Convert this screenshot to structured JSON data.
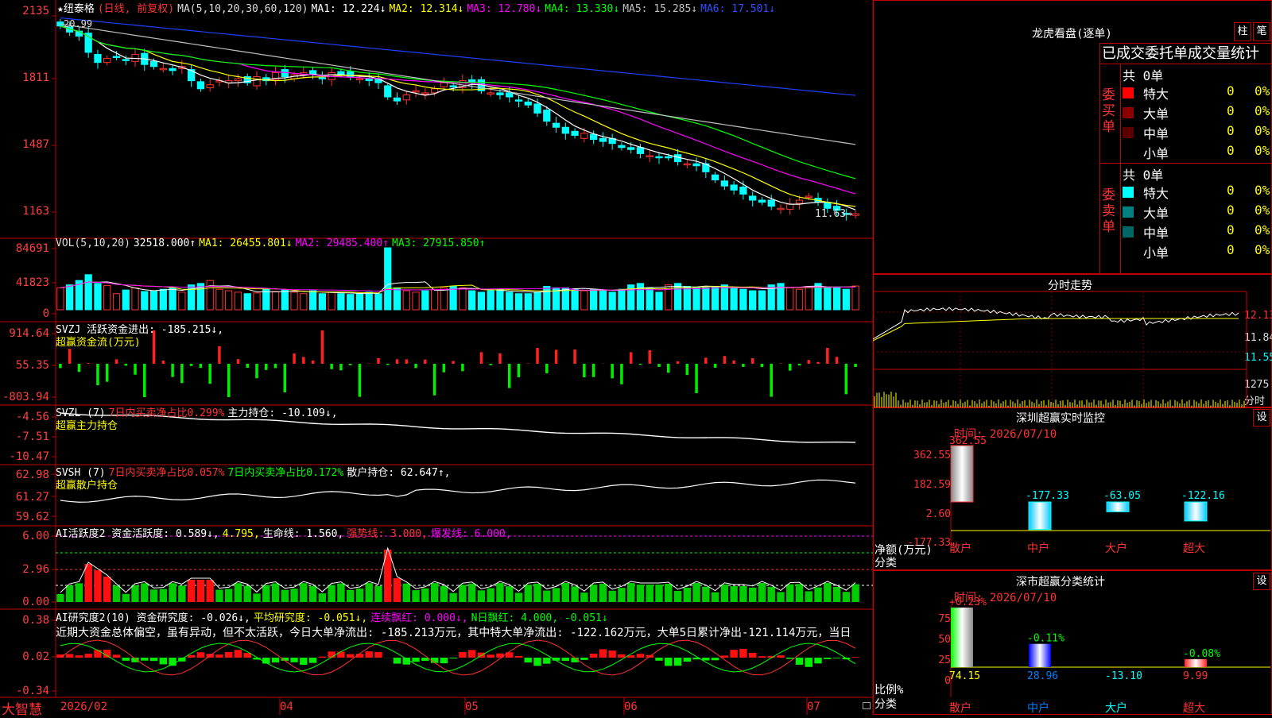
{
  "header": {
    "title": "★纽泰格",
    "period": "(日线, 前复权)",
    "ma_label": "MA(5,10,20,30,60,120)",
    "ma1": "MA1: 12.224↓",
    "ma2": "MA2: 12.314↓",
    "ma3": "MA3: 12.780↓",
    "ma4": "MA4: 13.330↓",
    "ma5": "MA5: 15.285↓",
    "ma6": "MA6: 17.501↓",
    "high_mark": "20.99",
    "low_mark": "11.63→"
  },
  "price_axis": [
    "2135",
    "1811",
    "1487",
    "1163"
  ],
  "vol": {
    "label": "VOL(5,10,20)",
    "value": "32518.000↑",
    "ma1": "MA1: 26455.801↓",
    "ma2": "MA2: 29485.400↑",
    "ma3": "MA3: 27915.850↑",
    "axis": [
      "84691",
      "41823",
      "0"
    ]
  },
  "svzj": {
    "label": "SVZJ  活跃资金进出: -185.215↓,",
    "sub": "超赢资金流(万元)",
    "axis": [
      "914.64",
      "55.35",
      "-803.94"
    ]
  },
  "svzl": {
    "label": "SVZL (7)",
    "pct": "7日内买卖净占比0.299%",
    "hold": "主力持仓: -10.109↓,",
    "sub": "超赢主力持仓",
    "axis": [
      "-4.56",
      "-7.51",
      "-10.47"
    ]
  },
  "svsh": {
    "label": "SVSH (7)",
    "pct1": "7日内买卖净占比0.057%",
    "pct2": "7日内买卖净占比0.172%",
    "hold": "散户持仓: 62.647↑,",
    "sub": "超赢散户持仓",
    "axis": [
      "62.98",
      "61.27",
      "59.62"
    ]
  },
  "ai1": {
    "label": "AI活跃度2 资金活跃度: 0.589↓,",
    "v2": "4.795,",
    "life": "生命线: 1.560,",
    "strong": "强势线: 3.000,",
    "burst": "爆发线: 6.000,",
    "axis": [
      "6.00",
      "2.96",
      "0.00"
    ]
  },
  "ai2": {
    "label": "AI研究度2(10) 资金研究度: -0.026↓,",
    "avg": "平均研究度: -0.051↓,",
    "red": "连续飘红: 0.000↓,",
    "nred": "N日飘红: 4.000, -0.051↓",
    "note": "近期大资金总体偏空，虽有异动，但不太活跃，今日大单净流出: -185.213万元，其中特大单净流出: -122.162万元，大单5日累计净出-121.114万元，当日",
    "axis": [
      "0.38",
      "0.02",
      "-0.34"
    ]
  },
  "xaxis": {
    "brand": "大智慧",
    "labels": [
      "2026/02",
      "04",
      "05",
      "06",
      "07"
    ]
  },
  "dragon": {
    "title": "龙虎看盘(逐单)",
    "btn1": "柱",
    "btn2": "笔",
    "tabs": "已成交委托单成交量统计",
    "buy_label": "委买单",
    "sell_label": "委卖单",
    "buy_total": "共 0单",
    "sell_total": "共 0单",
    "buy_rows": [
      {
        "name": "特大",
        "val": "0",
        "pct": "0%",
        "color": "#ff0000"
      },
      {
        "name": "大单",
        "val": "0",
        "pct": "0%",
        "color": "#8b0000"
      },
      {
        "name": "中单",
        "val": "0",
        "pct": "0%",
        "color": "#5a0000"
      },
      {
        "name": "小单",
        "val": "0",
        "pct": "0%",
        "color": "#000000"
      }
    ],
    "sell_rows": [
      {
        "name": "特大",
        "val": "0",
        "pct": "0%",
        "color": "#00ffff"
      },
      {
        "name": "大单",
        "val": "0",
        "pct": "0%",
        "color": "#008080"
      },
      {
        "name": "中单",
        "val": "0",
        "pct": "0%",
        "color": "#006666"
      },
      {
        "name": "小单",
        "val": "0",
        "pct": "0%",
        "color": "#000000"
      }
    ]
  },
  "intraday": {
    "title": "分时走势",
    "axis": [
      "12.13",
      "11.84",
      "11.55",
      "1275",
      "分时"
    ]
  },
  "monitor": {
    "title": "深圳超赢实时监控",
    "btn": "设",
    "date": "时间: 2026/07/10",
    "axis": [
      "362.55",
      "182.59",
      "2.60",
      "-177.33"
    ],
    "unit": "净额(万元)",
    "cls": "分类",
    "cats": [
      "散户",
      "中户",
      "大户",
      "超大"
    ],
    "values": [
      "362.55",
      "-177.33",
      "-63.05",
      "-122.16"
    ]
  },
  "classify": {
    "title": "深市超赢分类统计",
    "btn": "设",
    "date": "时间: 2026/07/10",
    "axis": [
      "75",
      "50",
      "25",
      "0"
    ],
    "unit": "比例%",
    "cls": "分类",
    "cats": [
      "散户",
      "中户",
      "大户",
      "超大"
    ],
    "top": [
      "+0.23%",
      "-0.11%",
      "",
      "-0.08%"
    ],
    "bottom": [
      "74.15",
      "28.96",
      "-13.10",
      "9.99"
    ]
  },
  "chart_data": [
    {
      "type": "candlestick",
      "title": "纽泰格 (日线, 前复权)",
      "ylim": [
        11.4,
        21.4
      ],
      "y_ticks": [
        "2135",
        "1811",
        "1487",
        "1163"
      ],
      "close_approx": [
        20.9,
        20.6,
        20.4,
        19.6,
        19.1,
        19.3,
        19.4,
        19.2,
        19.5,
        19.0,
        18.9,
        18.8,
        18.7,
        18.9,
        18.2,
        17.8,
        18.0,
        18.2,
        18.2,
        18.3,
        18.1,
        18.4,
        18.2,
        18.6,
        18.4,
        18.5,
        18.6,
        18.5,
        18.3,
        18.6,
        18.5,
        18.4,
        18.3,
        18.2,
        18.1,
        17.4,
        17.2,
        17.5,
        17.7,
        17.6,
        17.8,
        18.1,
        17.9,
        18.2,
        18.1,
        17.7,
        17.6,
        17.5,
        17.4,
        17.2,
        17.0,
        16.6,
        16.2,
        15.9,
        15.6,
        15.5,
        15.6,
        15.3,
        15.2,
        15.1,
        14.9,
        14.8,
        14.6,
        14.5,
        14.4,
        14.4,
        14.2,
        14.1,
        14.0,
        13.7,
        13.3,
        13.0,
        12.8,
        12.6,
        12.3,
        12.2,
        12.0,
        11.9,
        12.1,
        12.3,
        12.5,
        12.2,
        11.9,
        11.8,
        11.6,
        11.63
      ],
      "series_ma": [
        "MA1: 12.224",
        "MA2: 12.314",
        "MA3: 12.780",
        "MA4: 13.330",
        "MA5: 15.285",
        "MA6: 17.501"
      ]
    },
    {
      "type": "bar",
      "title": "VOL(5,10,20)",
      "ylim": [
        0,
        84691
      ],
      "values_approx": [
        30000,
        34000,
        40000,
        48000,
        36000,
        33000,
        22000,
        27000,
        30000,
        25000,
        26000,
        28000,
        30000,
        24000,
        34000,
        36000,
        40000,
        28000,
        26000,
        24000,
        22000,
        23000,
        28000,
        25000,
        27000,
        24000,
        22000,
        26000,
        22000,
        24000,
        22000,
        21000,
        22000,
        24000,
        22000,
        84691,
        30000,
        26000,
        24000,
        26000,
        28000,
        30000,
        32000,
        30000,
        26000,
        24000,
        26000,
        28000,
        24000,
        22000,
        22000,
        24000,
        32000,
        30000,
        30000,
        28000,
        26000,
        28000,
        26000,
        24000,
        28000,
        34000,
        36000,
        30000,
        24000,
        34000,
        36000,
        32000,
        30000,
        30000,
        32000,
        34000,
        30000,
        28000,
        26000,
        26000,
        34000,
        36000,
        30000,
        28000,
        32000,
        36000,
        30000,
        30000,
        28000,
        32518
      ]
    }
  ]
}
